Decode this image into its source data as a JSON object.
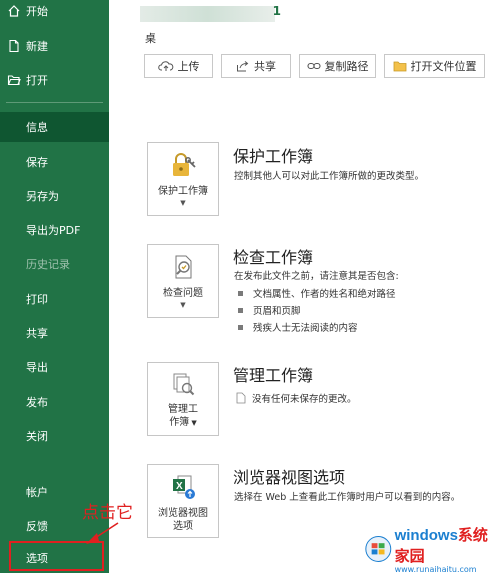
{
  "sidebar": {
    "top_items": [
      {
        "label": "开始",
        "icon": "home-icon"
      },
      {
        "label": "新建",
        "icon": "new-file-icon"
      },
      {
        "label": "打开",
        "icon": "open-folder-icon"
      }
    ],
    "items": [
      {
        "label": "信息",
        "active": true
      },
      {
        "label": "保存"
      },
      {
        "label": "另存为"
      },
      {
        "label": "导出为PDF"
      },
      {
        "label": "历史记录",
        "disabled": true
      },
      {
        "label": "打印"
      },
      {
        "label": "共享"
      },
      {
        "label": "导出"
      },
      {
        "label": "发布"
      },
      {
        "label": "关闭"
      }
    ],
    "bottom_items": [
      {
        "label": "帐户"
      },
      {
        "label": "反馈"
      },
      {
        "label": "选项"
      }
    ]
  },
  "file": {
    "name_fragment": "桌"
  },
  "actions": {
    "upload": "上传",
    "share": "共享",
    "copy_path": "复制路径",
    "open_location": "打开文件位置"
  },
  "sections": {
    "protect": {
      "button": "保护工作簿",
      "title": "保护工作簿",
      "desc": "控制其他人可以对此工作簿所做的更改类型。"
    },
    "inspect": {
      "button": "检查问题",
      "title": "检查工作簿",
      "desc": "在发布此文件之前，请注意其是否包含:",
      "bullets": [
        "文档属性、作者的姓名和绝对路径",
        "页眉和页脚",
        "残疾人士无法阅读的内容"
      ]
    },
    "manage": {
      "button_line1": "管理工",
      "button_line2": "作簿",
      "title": "管理工作簿",
      "desc": "没有任何未保存的更改。"
    },
    "browser": {
      "button_line1": "浏览器视图",
      "button_line2": "选项",
      "title": "浏览器视图选项",
      "desc": "选择在 Web 上查看此工作簿时用户可以看到的内容。"
    }
  },
  "annotation": {
    "text": "点击它",
    "color": "#e02020"
  },
  "watermark": {
    "main_a": "windows",
    "main_b": "系统家园",
    "sub": "www.runaihaitu.com"
  },
  "colors": {
    "sidebar": "#217346",
    "sidebar_active": "#0f5631",
    "accent_red": "#e02020"
  }
}
